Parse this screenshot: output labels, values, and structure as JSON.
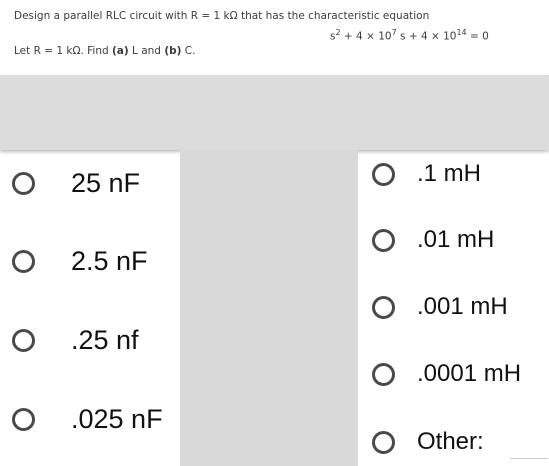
{
  "question": {
    "line1": "Design a parallel RLC circuit with R = 1 kΩ that has the characteristic equation",
    "equation": {
      "part1": "s",
      "exp1": "2",
      "part2": " + 4 × 10",
      "exp2": "7",
      "part3": " s + 4 × 10",
      "exp3": "14",
      "part4": " = 0"
    },
    "line3_prefix": "Let R = 1 kΩ. Find ",
    "line3_a": "(a)",
    "line3_mid": " L and ",
    "line3_b": "(b)",
    "line3_end": " C."
  },
  "capacitance_options": [
    {
      "label": "25 nF"
    },
    {
      "label": "2.5 nF"
    },
    {
      "label": ".25 nf"
    },
    {
      "label": ".025 nF"
    }
  ],
  "inductance_options": [
    {
      "label": ".1 mH"
    },
    {
      "label": ".01 mH"
    },
    {
      "label": ".001 mH"
    },
    {
      "label": ".0001 mH"
    },
    {
      "label": "Other:"
    }
  ]
}
